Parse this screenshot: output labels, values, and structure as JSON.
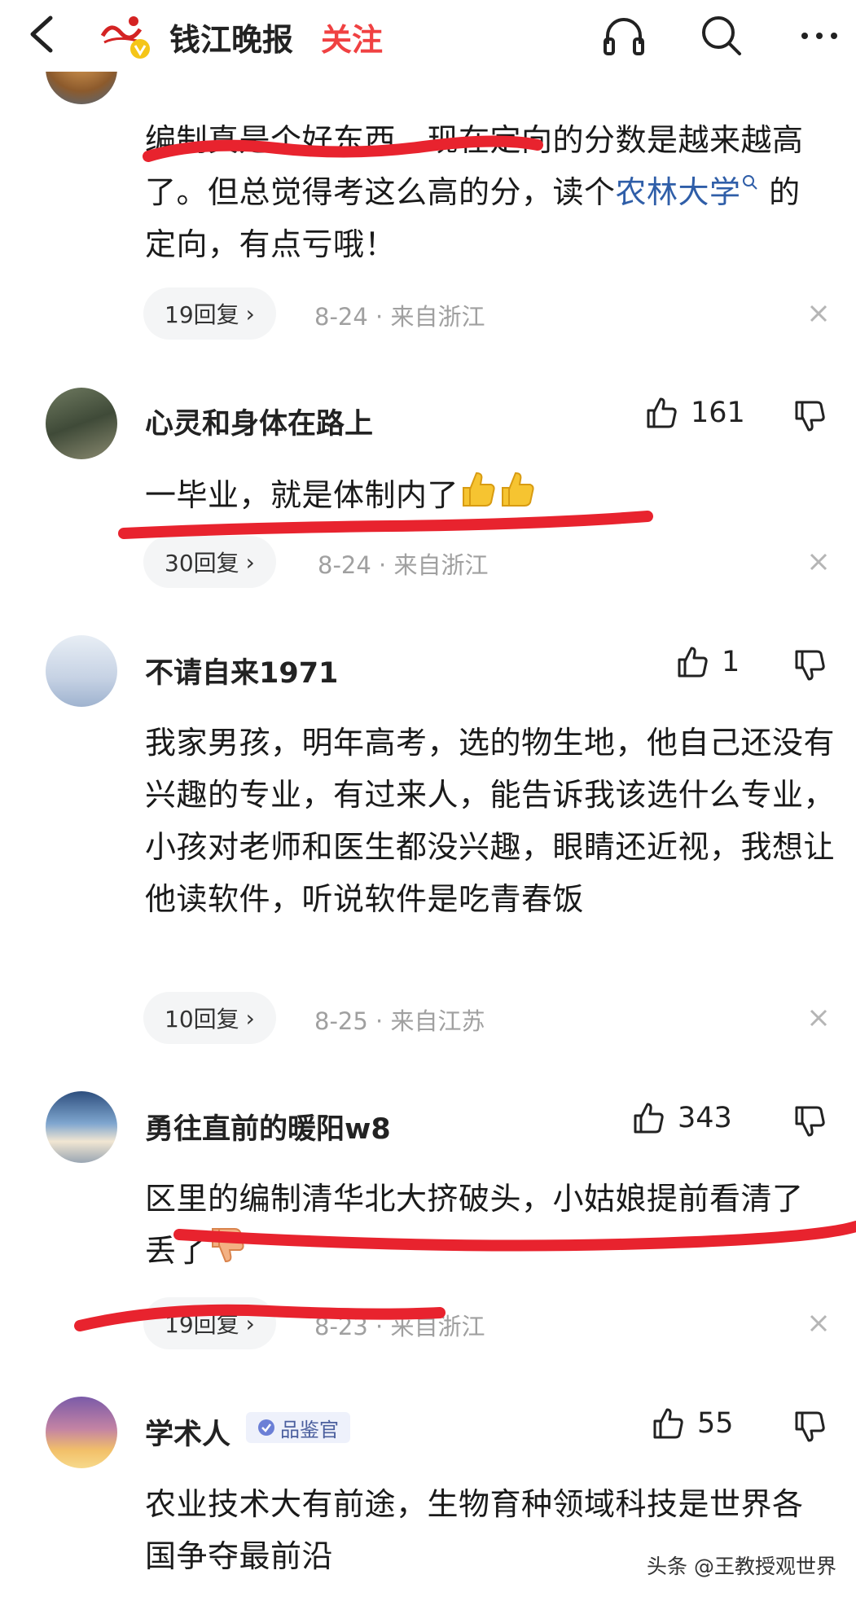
{
  "header": {
    "source_name": "钱江晚报",
    "follow_label": "关注",
    "icons": [
      "back-icon",
      "headphones-icon",
      "search-icon",
      "more-icon"
    ]
  },
  "comments": [
    {
      "text_a": "编制真是个好东西，现在定向的分数是越来越高了。但总觉得考这么高的分，读个",
      "link": "农林大学",
      "text_b": " 的定向，有点亏哦！",
      "replies": "19回复",
      "date": "8-24",
      "location": "来自浙江"
    },
    {
      "username": "心灵和身体在路上",
      "likes": "161",
      "text": "一毕业，就是体制内了",
      "replies": "30回复",
      "date": "8-24",
      "location": "来自浙江"
    },
    {
      "username": "不请自来1971",
      "likes": "1",
      "text": "我家男孩，明年高考，选的物生地，他自己还没有兴趣的专业，有过来人，能告诉我该选什么专业，小孩对老师和医生都没兴趣，眼睛还近视，我想让他读软件，听说软件是吃青春饭",
      "replies": "10回复",
      "date": "8-25",
      "location": "来自江苏"
    },
    {
      "username": "勇往直前的暖阳w8",
      "likes": "343",
      "text": "区里的编制清华北大挤破头，小姑娘提前看清了丢了",
      "replies": "19回复",
      "date": "8-23",
      "location": "来自浙江"
    },
    {
      "username": "学术人",
      "badge": "品鉴官",
      "likes": "55",
      "text": "农业技术大有前途，生物育种领域科技是世界各国争夺最前沿"
    }
  ],
  "meta_separator": "·",
  "watermark": "头条 @王教授观世界",
  "colors": {
    "accent_red": "#f04142",
    "link_blue": "#2f5ea8",
    "annotation_red": "#e8232e"
  }
}
